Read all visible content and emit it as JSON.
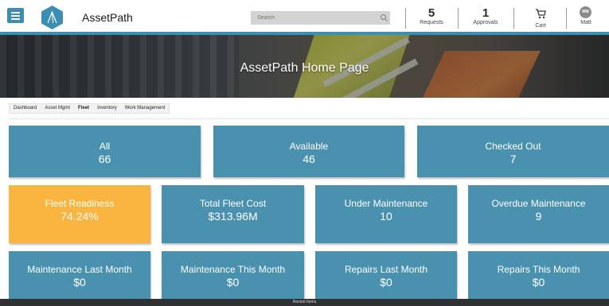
{
  "header": {
    "app_name": "AssetPath",
    "search_placeholder": "Search",
    "requests": {
      "count": "5",
      "label": "Requests"
    },
    "approvals": {
      "count": "1",
      "label": "Approvals"
    },
    "cart_label": "Cart",
    "user": {
      "initials": "MM",
      "name": "Matt"
    },
    "icons": {
      "menu": "hamburger-menu-icon",
      "logo": "assetpath-logo-icon",
      "search": "search-icon",
      "cart": "cart-icon",
      "avatar": "user-avatar"
    }
  },
  "banner": {
    "title": "AssetPath Home Page"
  },
  "tabs": [
    {
      "label": "Dashboard",
      "active": false
    },
    {
      "label": "Asset Mgmt",
      "active": false
    },
    {
      "label": "Fleet",
      "active": true
    },
    {
      "label": "Inventory",
      "active": false
    },
    {
      "label": "Work Management",
      "active": false
    }
  ],
  "summary_tiles": [
    {
      "label": "All",
      "value": "66"
    },
    {
      "label": "Available",
      "value": "46"
    },
    {
      "label": "Checked Out",
      "value": "7"
    }
  ],
  "metric_tiles": [
    {
      "label": "Fleet Readiness",
      "value": "74.24%"
    },
    {
      "label": "Total Fleet Cost",
      "value": "$313.96M"
    },
    {
      "label": "Under Maintenance",
      "value": "10"
    },
    {
      "label": "Overdue Maintenance",
      "value": "9"
    }
  ],
  "maintenance_tiles": [
    {
      "label": "Maintenance Last Month",
      "value": "$0"
    },
    {
      "label": "Maintenance This Month",
      "value": "$0"
    },
    {
      "label": "Repairs Last Month",
      "value": "$0"
    },
    {
      "label": "Repairs This Month",
      "value": "$0"
    }
  ],
  "footer": {
    "label": "Recent Items"
  },
  "colors": {
    "accent": "#4a91b0",
    "highlight": "#f9b53f",
    "header_border": "#3b8fb0"
  }
}
